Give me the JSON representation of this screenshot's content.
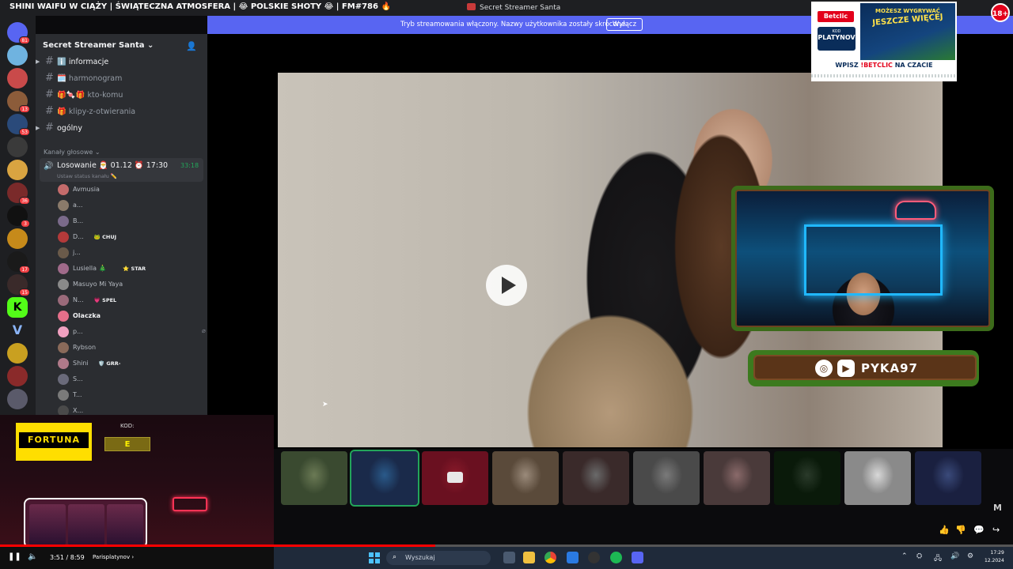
{
  "window": {
    "stream_title": "SHINI WAIFU W CIĄŻY | ŚWIĄTECZNA ATMOSFERA | 😂 POLSKIE SHOTY 😂 | FM#786 🔥",
    "app_title": "Secret Streamer Santa"
  },
  "banner": {
    "text": "Tryb streamowania włączony. Nazwy użytkownika zostały skrócone.",
    "button": "Wyłącz"
  },
  "servers": [
    {
      "badge": "81",
      "color": "#5865f2"
    },
    {
      "badge": "",
      "color": "#6fb3e0"
    },
    {
      "badge": "",
      "color": "#c94a4a"
    },
    {
      "badge": "13",
      "color": "#8c5c3a"
    },
    {
      "badge": "53",
      "color": "#2a4a7a"
    },
    {
      "badge": "",
      "color": "#3a3a3a"
    },
    {
      "badge": "",
      "color": "#d9a441"
    },
    {
      "badge": "36",
      "color": "#7a2a2a"
    },
    {
      "badge": "3",
      "color": "#111111"
    },
    {
      "badge": "",
      "color": "#c68a1a"
    },
    {
      "badge": "17",
      "color": "#1a1a1a"
    },
    {
      "badge": "15",
      "color": "#3a2a2a"
    }
  ],
  "sidebar": {
    "server_name": "Secret Streamer Santa",
    "channels": [
      {
        "name": "ℹ️ informacje",
        "bright": true,
        "expand": true
      },
      {
        "name": "🗓️ harmonogram",
        "bright": false,
        "expand": false
      },
      {
        "name": "🎁🍬🎁 kto-komu",
        "bright": false,
        "expand": false
      },
      {
        "name": "🎁 klipy-z-otwierania",
        "bright": false,
        "expand": false
      },
      {
        "name": "ogólny",
        "bright": true,
        "expand": true
      }
    ],
    "voice_category": "Kanały głosowe",
    "voice_channel": {
      "name": "Losowanie 🎅 01.12 ⏰ 17:30",
      "timer": "33:18",
      "status": "Ustaw status kanału ✏️"
    },
    "members": [
      {
        "name": "Avmusia",
        "tag": "",
        "bright": false,
        "color": "#c46b6b",
        "icons": "mic-off"
      },
      {
        "name": "a...",
        "tag": "",
        "bright": false,
        "color": "#8a7a6a",
        "icons": ""
      },
      {
        "name": "B...",
        "tag": "",
        "bright": false,
        "color": "#7a6a8a",
        "icons": "mic-off"
      },
      {
        "name": "D...",
        "tag": "🐸 CHUJ",
        "bright": false,
        "color": "#b33a3a",
        "icons": "mic-off"
      },
      {
        "name": "j...",
        "tag": "",
        "bright": false,
        "color": "#6a5a4a",
        "icons": "cam"
      },
      {
        "name": "Lusiella 🎄",
        "tag": "⭐ STAR",
        "bright": false,
        "color": "#a06a8a",
        "icons": "cam"
      },
      {
        "name": "Masuyo Mi Yaya",
        "tag": "",
        "bright": false,
        "color": "#8a8a8a",
        "icons": "cam"
      },
      {
        "name": "N...",
        "tag": "💗 SPEL",
        "bright": false,
        "color": "#9a6a7a",
        "icons": "cam"
      },
      {
        "name": "Olaczka",
        "tag": "",
        "bright": true,
        "color": "#e56f8a",
        "icons": ""
      },
      {
        "name": "p...",
        "tag": "",
        "bright": false,
        "color": "#f0a0c0",
        "icons": "mic-off cam"
      },
      {
        "name": "Rybson",
        "tag": "",
        "bright": false,
        "color": "#8a6a5a",
        "icons": "cam"
      },
      {
        "name": "Shini",
        "tag": "🛡️ GRR-",
        "bright": false,
        "color": "#b07a8a",
        "icons": "cam"
      },
      {
        "name": "S...",
        "tag": "",
        "bright": false,
        "color": "#6a6a7a",
        "icons": "cam"
      },
      {
        "name": "T...",
        "tag": "",
        "bright": false,
        "color": "#7a7a7a",
        "icons": "mic-off"
      },
      {
        "name": "X...",
        "tag": "",
        "bright": false,
        "color": "#4a4a4a",
        "icons": "mic-off"
      }
    ]
  },
  "overlay": {
    "streamer_name": "PYKA97",
    "ad": {
      "logo": "Betclic",
      "promo_line1": "MOŻESZ WYGRYWAĆ",
      "promo_line2": "JESZCZE WIĘCEJ",
      "kod_label": "KOD",
      "kod": "PLATYNOV",
      "bottom_prefix": "WPISZ",
      "bottom_brand": "!BETCLIC",
      "bottom_suffix": "NA CZACIE"
    },
    "age_badge": "18+",
    "fortuna": "FORTUNA",
    "kod_label": "KOD:",
    "kod_value": "E"
  },
  "participants": [
    {
      "color1": "#6b7a55",
      "color2": "#3a4a30",
      "active": false,
      "cam_off": false
    },
    {
      "color1": "#2a5a8a",
      "color2": "#1a2a4a",
      "active": true,
      "cam_off": false
    },
    {
      "color1": "#8a1a2a",
      "color2": "#6a1020",
      "active": false,
      "cam_off": true
    },
    {
      "color1": "#9a8a7a",
      "color2": "#5a4a3a",
      "active": false,
      "cam_off": false
    },
    {
      "color1": "#6a6a6a",
      "color2": "#3a2a2a",
      "active": false,
      "cam_off": false
    },
    {
      "color1": "#7a7a7a",
      "color2": "#4a4a4a",
      "active": false,
      "cam_off": false
    },
    {
      "color1": "#8a6a6a",
      "color2": "#4a3a3a",
      "active": false,
      "cam_off": false
    },
    {
      "color1": "#2a3a2a",
      "color2": "#0a1a0a",
      "active": false,
      "cam_off": false
    },
    {
      "color1": "#d8d8d8",
      "color2": "#8a8a8a",
      "active": false,
      "cam_off": false
    },
    {
      "color1": "#3a4a7a",
      "color2": "#1a2040",
      "active": false,
      "cam_off": false
    }
  ],
  "player": {
    "time": "3:51 / 8:59",
    "chapter": "Parisplatynov ›",
    "progress": 0.43
  },
  "taskbar": {
    "search_placeholder": "Wyszukaj",
    "clock_time": "17:29",
    "clock_date": "12.2024"
  }
}
